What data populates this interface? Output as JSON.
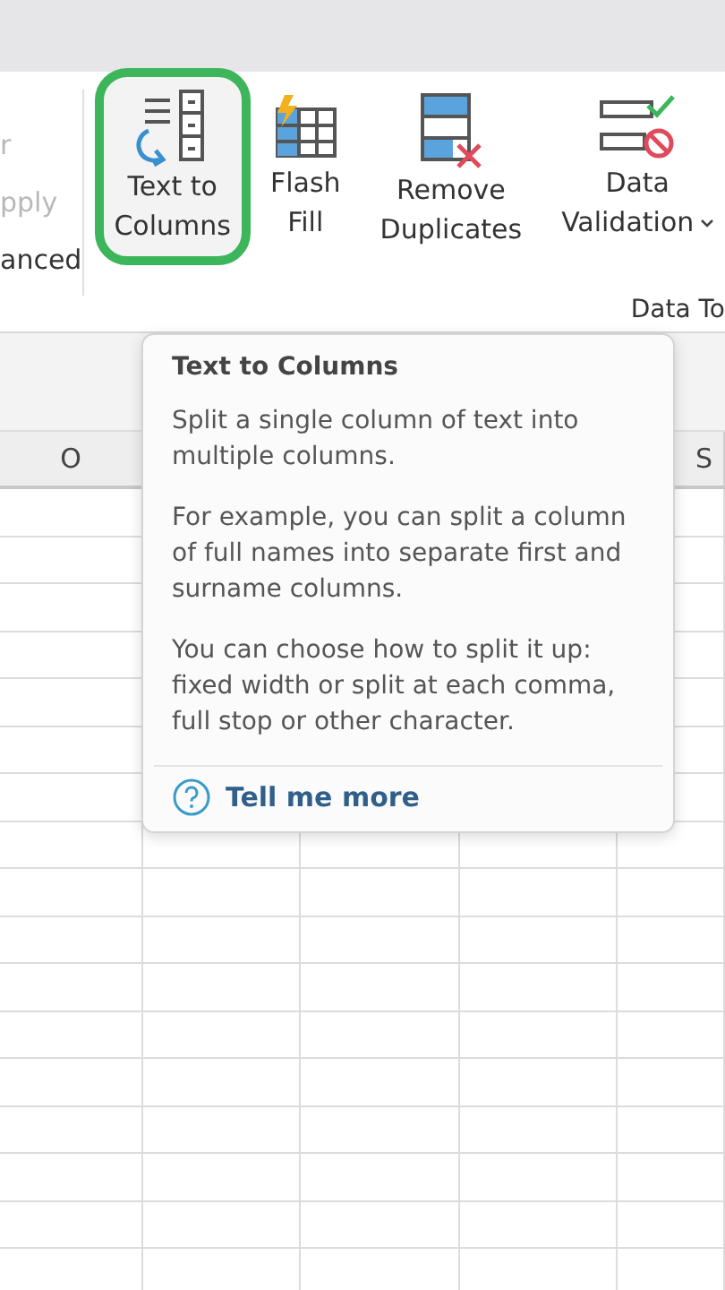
{
  "ribbon": {
    "left_items": [
      {
        "label": "r",
        "disabled": true
      },
      {
        "label": "pply",
        "disabled": true
      },
      {
        "label": "anced",
        "disabled": false
      }
    ],
    "buttons": [
      {
        "kind": "text_to_columns",
        "lines": [
          "Text to",
          "Columns"
        ],
        "highlighted": true,
        "dropdown": false
      },
      {
        "kind": "flash_fill",
        "lines": [
          "Flash",
          "Fill"
        ],
        "highlighted": false,
        "dropdown": false
      },
      {
        "kind": "remove_duplicates",
        "lines": [
          "Remove",
          "Duplicates"
        ],
        "highlighted": false,
        "dropdown": false
      },
      {
        "kind": "data_validation",
        "lines": [
          "Data",
          "Validation"
        ],
        "highlighted": false,
        "dropdown": true
      }
    ],
    "group_label": "Data To"
  },
  "sheet": {
    "first_column": "O",
    "last_column": "S"
  },
  "tooltip": {
    "title": "Text to Columns",
    "paragraphs": [
      "Split a single column of text into multiple columns.",
      "For example, you can split a column of full names into separate first and surname columns.",
      "You can choose how to split it up: fixed width or split at each comma, full stop or other character."
    ],
    "link": "Tell me more"
  }
}
